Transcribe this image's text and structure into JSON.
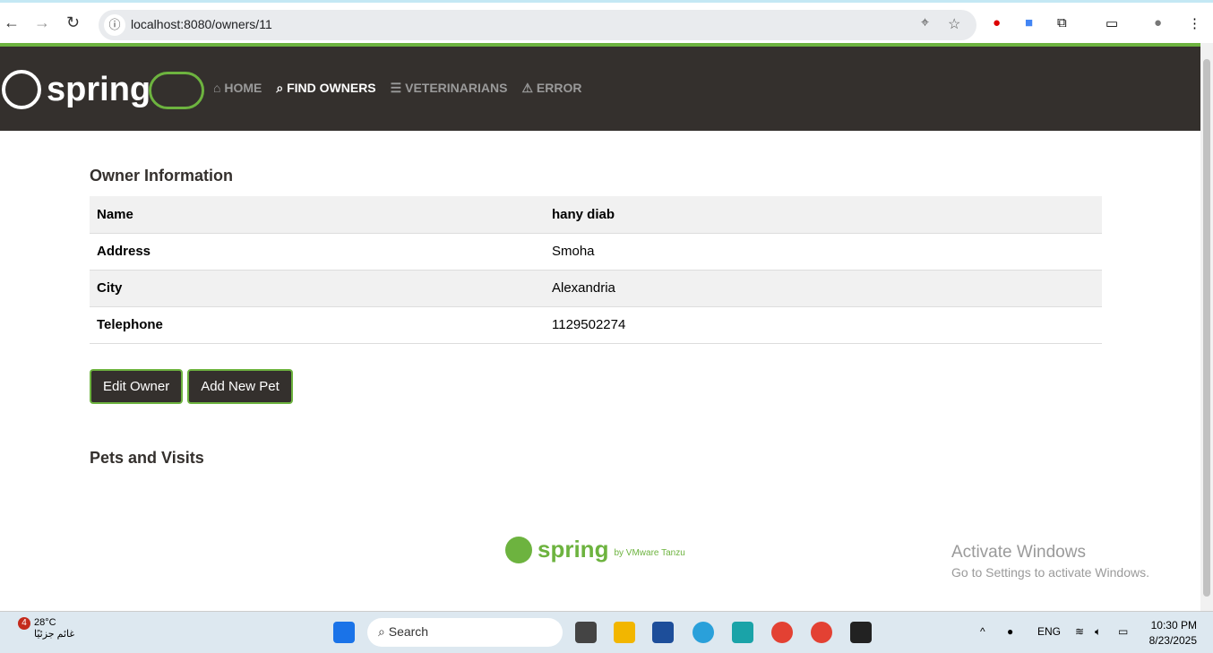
{
  "browser": {
    "url": "localhost:8080/owners/11"
  },
  "nav": {
    "brand": "spring",
    "items": [
      {
        "label": "HOME",
        "icon": "home-icon"
      },
      {
        "label": "FIND OWNERS",
        "icon": "search-icon"
      },
      {
        "label": "VETERINARIANS",
        "icon": "list-icon"
      },
      {
        "label": "ERROR",
        "icon": "warning-icon"
      }
    ]
  },
  "owner": {
    "title": "Owner Information",
    "rows": [
      {
        "key": "Name",
        "value": "hany diab"
      },
      {
        "key": "Address",
        "value": "Smoha"
      },
      {
        "key": "City",
        "value": "Alexandria"
      },
      {
        "key": "Telephone",
        "value": "1129502274"
      }
    ]
  },
  "buttons": {
    "edit": "Edit Owner",
    "add_pet": "Add New Pet"
  },
  "pets": {
    "title": "Pets and Visits"
  },
  "footer": {
    "brand": "spring",
    "by": "by VMware Tanzu"
  },
  "watermark": {
    "title": "Activate Windows",
    "subtitle": "Go to Settings to activate Windows."
  },
  "taskbar": {
    "temp": "28°C",
    "weather": "غائم جزئيًا",
    "badge": "4",
    "search": "Search",
    "lang": "ENG",
    "time": "10:30 PM",
    "date": "8/23/2025"
  },
  "colors": {
    "accent": "#6db33f",
    "header": "#34302d"
  }
}
